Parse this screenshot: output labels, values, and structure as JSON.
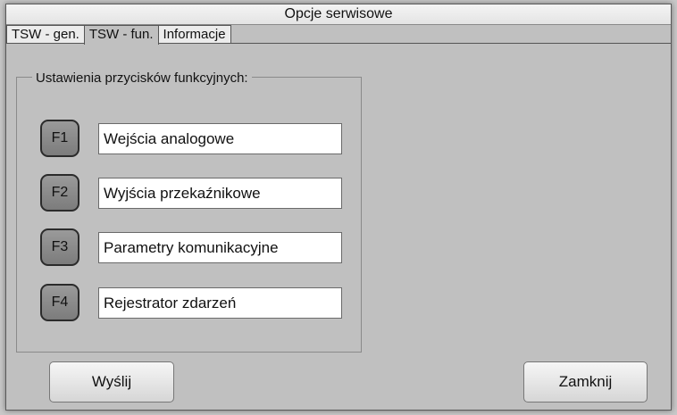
{
  "window": {
    "title": "Opcje serwisowe"
  },
  "tabs": [
    {
      "label": "TSW - gen."
    },
    {
      "label": "TSW - fun.",
      "active": true
    },
    {
      "label": "Informacje"
    }
  ],
  "group": {
    "legend": "Ustawienia przycisków funkcyjnych:"
  },
  "function_keys": [
    {
      "key": "F1",
      "value": "Wejścia analogowe"
    },
    {
      "key": "F2",
      "value": "Wyjścia przekaźnikowe"
    },
    {
      "key": "F3",
      "value": "Parametry komunikacyjne"
    },
    {
      "key": "F4",
      "value": "Rejestrator zdarzeń"
    }
  ],
  "buttons": {
    "send": "Wyślij",
    "close": "Zamknij"
  }
}
